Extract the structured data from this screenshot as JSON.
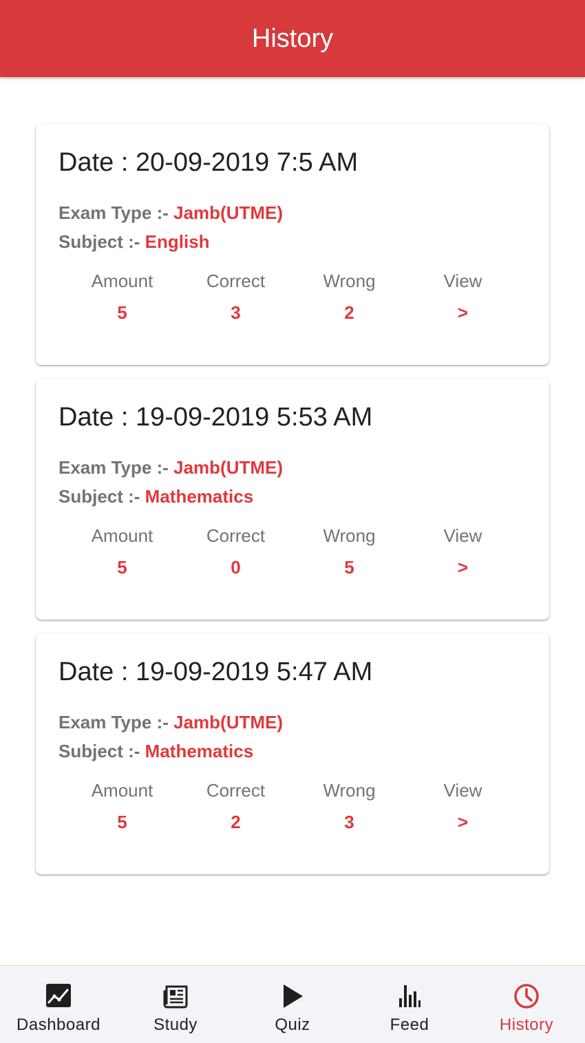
{
  "header": {
    "title": "History"
  },
  "history": [
    {
      "date": "Date : 20-09-2019 7:5 AM",
      "exam_type_label": "Exam Type :- ",
      "exam_type": "Jamb(UTME)",
      "subject_label": "Subject :- ",
      "subject": "English",
      "stats": [
        {
          "label": "Amount",
          "value": "5"
        },
        {
          "label": "Correct",
          "value": "3"
        },
        {
          "label": "Wrong",
          "value": "2"
        },
        {
          "label": "View",
          "value": ">"
        }
      ]
    },
    {
      "date": "Date : 19-09-2019 5:53 AM",
      "exam_type_label": "Exam Type :- ",
      "exam_type": "Jamb(UTME)",
      "subject_label": "Subject :- ",
      "subject": "Mathematics",
      "stats": [
        {
          "label": "Amount",
          "value": "5"
        },
        {
          "label": "Correct",
          "value": "0"
        },
        {
          "label": "Wrong",
          "value": "5"
        },
        {
          "label": "View",
          "value": ">"
        }
      ]
    },
    {
      "date": "Date : 19-09-2019 5:47 AM",
      "exam_type_label": "Exam Type :- ",
      "exam_type": "Jamb(UTME)",
      "subject_label": "Subject :- ",
      "subject": "Mathematics",
      "stats": [
        {
          "label": "Amount",
          "value": "5"
        },
        {
          "label": "Correct",
          "value": "2"
        },
        {
          "label": "Wrong",
          "value": "3"
        },
        {
          "label": "View",
          "value": ">"
        }
      ]
    }
  ],
  "nav": {
    "items": [
      {
        "label": "Dashboard",
        "icon": "chart-line-icon"
      },
      {
        "label": "Study",
        "icon": "newspaper-icon"
      },
      {
        "label": "Quiz",
        "icon": "play-icon"
      },
      {
        "label": "Feed",
        "icon": "bar-chart-icon"
      },
      {
        "label": "History",
        "icon": "clock-icon",
        "active": true
      }
    ]
  },
  "colors": {
    "brand": "#d63a3c",
    "accent_text": "#e0393c",
    "muted_text": "#737373",
    "nav_background": "#f3f4f8"
  }
}
